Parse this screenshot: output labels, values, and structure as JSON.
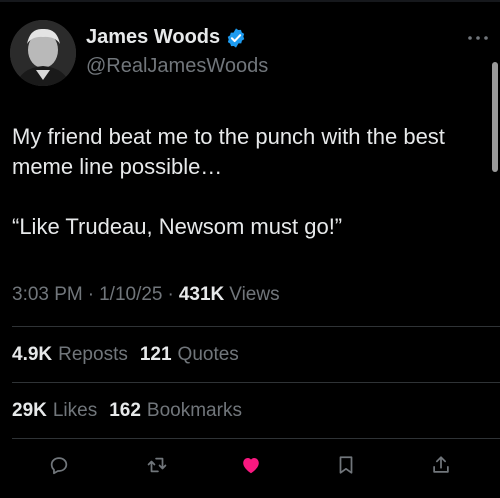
{
  "colors": {
    "background": "#000000",
    "text": "#e7e9ea",
    "secondary": "#71767b",
    "verified": "#1d9bf0",
    "like_active": "#f91880",
    "divider": "#2f3336"
  },
  "author": {
    "name": "James Woods",
    "handle": "@RealJamesWoods",
    "verified": true,
    "avatar_icon": "profile-photo"
  },
  "tweet": {
    "line1": "My friend beat me to the punch with the best meme line possible…",
    "line2": "“Like Trudeau, Newsom must go!”"
  },
  "meta": {
    "time": "3:03 PM",
    "date": "1/10/25",
    "views_count": "431K",
    "views_label": "Views",
    "separator": "·"
  },
  "stats": {
    "reposts_count": "4.9K",
    "reposts_label": "Reposts",
    "quotes_count": "121",
    "quotes_label": "Quotes",
    "likes_count": "29K",
    "likes_label": "Likes",
    "bookmarks_count": "162",
    "bookmarks_label": "Bookmarks"
  },
  "actions": [
    {
      "name": "reply",
      "icon": "reply-icon"
    },
    {
      "name": "repost",
      "icon": "repost-icon"
    },
    {
      "name": "like",
      "icon": "heart-icon",
      "active": true
    },
    {
      "name": "bookmark",
      "icon": "bookmark-icon"
    },
    {
      "name": "share",
      "icon": "share-icon"
    }
  ]
}
